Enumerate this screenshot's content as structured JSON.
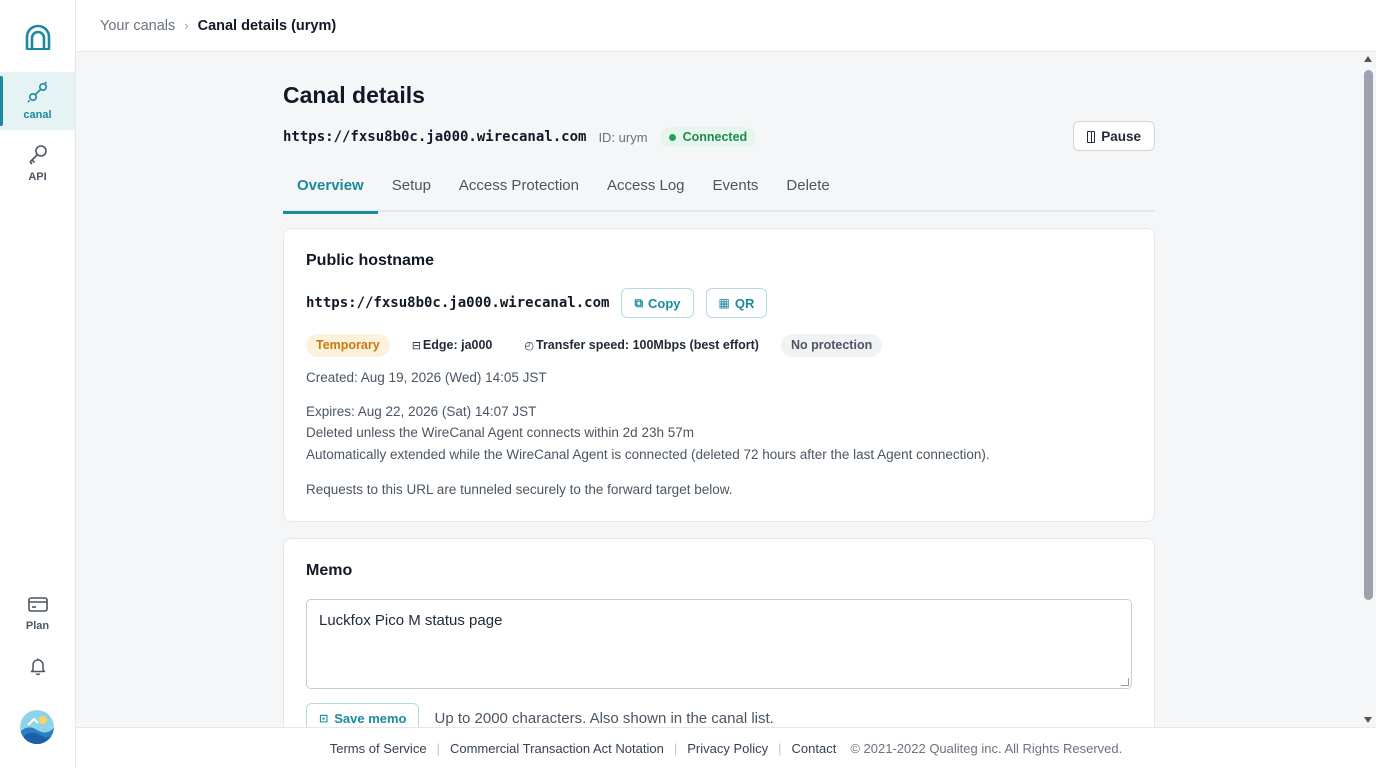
{
  "sidebar": {
    "logo": "arch-logo-icon",
    "items": [
      {
        "label": "canal",
        "icon": "plug-link-icon",
        "active": true
      },
      {
        "label": "API",
        "icon": "key-icon",
        "active": false
      },
      {
        "label": "Plan",
        "icon": "card-icon",
        "active": false
      }
    ],
    "notification_icon": "bell-icon",
    "avatar_icon": "user-avatar-icon"
  },
  "breadcrumb": {
    "parent": "Your canals",
    "separator": "›",
    "current": "Canal details (urym)"
  },
  "page": {
    "title": "Canal details",
    "url": "https://fxsu8b0c.ja000.wirecanal.com",
    "id_text": "ID: urym",
    "status": "Connected",
    "pause_label": "Pause"
  },
  "tabs": [
    {
      "label": "Overview",
      "active": true
    },
    {
      "label": "Setup",
      "active": false
    },
    {
      "label": "Access Protection",
      "active": false
    },
    {
      "label": "Access Log",
      "active": false
    },
    {
      "label": "Events",
      "active": false
    },
    {
      "label": "Delete",
      "active": false
    }
  ],
  "hostname_card": {
    "title": "Public hostname",
    "url": "https://fxsu8b0c.ja000.wirecanal.com",
    "copy_label": "Copy",
    "qr_label": "QR",
    "badges": {
      "temporary": "Temporary",
      "edge": "Edge: ja000",
      "speed": "Transfer speed: 100Mbps (best effort)",
      "protection": "No protection"
    },
    "created": "Created: Aug 19, 2026 (Wed) 14:05 JST",
    "expires": "Expires: Aug 22, 2026 (Sat) 14:07 JST",
    "deleted_notice": "Deleted unless the WireCanal Agent connects within 2d 23h 57m",
    "extended_notice": "Automatically extended while the WireCanal Agent is connected (deleted 72 hours after the last Agent connection).",
    "tunnel_note": "Requests to this URL are tunneled securely to the forward target below."
  },
  "memo_card": {
    "title": "Memo",
    "value": "Luckfox Pico M status page",
    "save_label": "Save memo",
    "hint": "Up to 2000 characters. Also shown in the canal list."
  },
  "footer": {
    "links": [
      "Terms of Service",
      "Commercial Transaction Act Notation",
      "Privacy Policy",
      "Contact"
    ],
    "copyright": "© 2021-2022 Qualiteg inc. All Rights Reserved."
  },
  "colors": {
    "accent": "#1c8a9e",
    "connected": "#22a356",
    "temporary": "#c57a10"
  }
}
